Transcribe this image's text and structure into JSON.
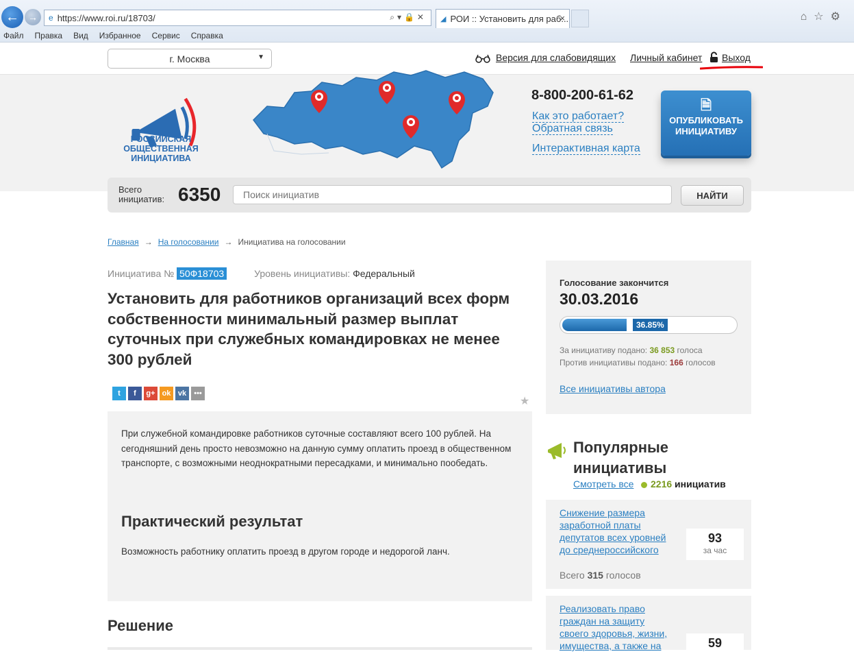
{
  "browser": {
    "url": "https://www.roi.ru/18703/",
    "tab_title": "РОИ :: Установить для раб...",
    "tab_close": "×",
    "menu": [
      "Файл",
      "Правка",
      "Вид",
      "Избранное",
      "Сервис",
      "Справка"
    ]
  },
  "topbar": {
    "city": "г. Москва",
    "accessibility_link": "Версия для слабовидящих",
    "cabinet_link": "Личный кабинет",
    "logout_link": "Выход"
  },
  "header": {
    "logo_text": "РОССИЙСКАЯ ОБЩЕСТВЕННАЯ ИНИЦИАТИВА",
    "phone": "8-800-200-61-62",
    "how_it_works": "Как это работает?",
    "feedback": "Обратная связь",
    "interactive_map": "Интерактивная карта",
    "publish_button": "ОПУБЛИКОВАТЬ ИНИЦИАТИВУ"
  },
  "search": {
    "total_label": "Всего инициатив:",
    "total_count": "6350",
    "placeholder": "Поиск инициатив",
    "button": "НАЙТИ"
  },
  "breadcrumb": {
    "home": "Главная",
    "voting": "На голосовании",
    "current": "Инициатива на голосовании",
    "separator": "→"
  },
  "initiative": {
    "number_label": "Инициатива №",
    "number": "50Ф18703",
    "level_label": "Уровень инициативы:",
    "level": "Федеральный",
    "title": "Установить для работников организаций всех форм собственности минимальный размер выплат суточных при служебных командировках не менее 300 рублей",
    "description": "При служебной командировке работников суточные составляют всего 100 рублей. На сегодняшний день просто невозможно на данную сумму оплатить проезд в общественном транспорте, с возможными неоднократными пересадками, и минимально пообедать.",
    "result_title": "Практический результат",
    "result_text": "Возможность работнику оплатить проезд в другом городе и недорогой ланч.",
    "decision_title": "Решение"
  },
  "share": {
    "icons": [
      "twitter-icon",
      "facebook-icon",
      "google-plus-icon",
      "odnoklassniki-icon",
      "vk-icon",
      "more-icon"
    ],
    "colors": [
      "#2ea3e0",
      "#3b5998",
      "#dc4a38",
      "#f59a21",
      "#4c75a3",
      "#9a9a9a"
    ],
    "glyphs": [
      "t",
      "f",
      "g+",
      "ok",
      "vk",
      "•••"
    ]
  },
  "voting": {
    "ends_label": "Голосование закончится",
    "ends_date": "30.03.2016",
    "progress_label": "36.85%",
    "progress_fraction": 0.3685,
    "for_label": "За инициативу подано:",
    "for_count": "36 853",
    "for_unit": "голоса",
    "against_label": "Против инициативы подано:",
    "against_count": "166",
    "against_unit": "голосов",
    "author_link": "Все инициативы автора"
  },
  "popular": {
    "title": "Популярные инициативы",
    "see_all": "Смотреть все",
    "count": "2216",
    "count_unit": "инициатив",
    "items": [
      {
        "title": "Снижение размера заработной платы депутатов всех уровней до среднероссийского",
        "score": "93",
        "score_unit": "за час",
        "total_label": "Всего",
        "total": "315",
        "total_unit": "голосов"
      },
      {
        "title": "Реализовать право граждан на защиту своего здоровья, жизни, имущества, а также на",
        "score": "59"
      }
    ]
  },
  "colors": {
    "accent": "#2a7fc1",
    "brand_button": "#2570b5",
    "panel_bg": "#f2f2f2"
  }
}
